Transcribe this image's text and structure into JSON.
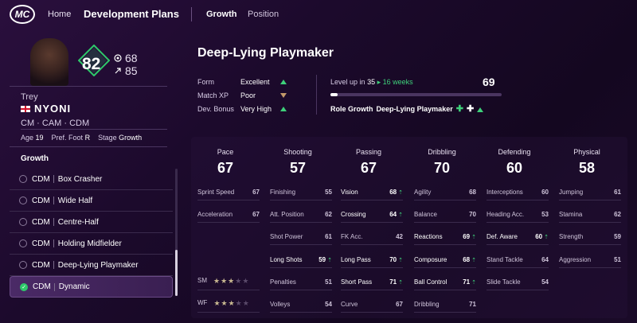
{
  "nav": {
    "logo": "MC",
    "home": "Home",
    "title": "Development Plans",
    "tabs": [
      "Growth",
      "Position"
    ]
  },
  "player": {
    "ovr": "82",
    "potential_a": "68",
    "potential_b": "85",
    "first_name": "Trey",
    "last_name": "NYONI",
    "positions": "CM · CAM · CDM",
    "age_label": "Age",
    "age": "19",
    "foot_label": "Pref. Foot",
    "foot": "R",
    "stage_label": "Stage",
    "stage": "Growth"
  },
  "growth": {
    "heading": "Growth",
    "plans": [
      {
        "pos": "CDM",
        "name": "Box Crasher"
      },
      {
        "pos": "CDM",
        "name": "Wide Half"
      },
      {
        "pos": "CDM",
        "name": "Centre-Half"
      },
      {
        "pos": "CDM",
        "name": "Holding Midfielder"
      },
      {
        "pos": "CDM",
        "name": "Deep-Lying Playmaker"
      },
      {
        "pos": "CDM",
        "name": "Dynamic"
      }
    ],
    "selected_index": 5
  },
  "role": {
    "title": "Deep-Lying Playmaker",
    "form_label": "Form",
    "form": "Excellent",
    "xp_label": "Match XP",
    "xp": "Poor",
    "bonus_label": "Dev. Bonus",
    "bonus": "Very High",
    "levelup_label": "Level up in",
    "levelup_from": "35",
    "levelup_weeks": "16 weeks",
    "level": "69",
    "progress": 0.04,
    "growth_label": "Role Growth",
    "growth_role": "Deep-Lying Playmaker"
  },
  "categories": [
    {
      "name": "Pace",
      "value": "67"
    },
    {
      "name": "Shooting",
      "value": "57"
    },
    {
      "name": "Passing",
      "value": "67"
    },
    {
      "name": "Dribbling",
      "value": "70"
    },
    {
      "name": "Defending",
      "value": "60"
    },
    {
      "name": "Physical",
      "value": "58"
    }
  ],
  "attributes": {
    "pace": [
      {
        "n": "Sprint Speed",
        "v": "67"
      },
      {
        "n": "Acceleration",
        "v": "67"
      }
    ],
    "shooting": [
      {
        "n": "Finishing",
        "v": "55"
      },
      {
        "n": "Att. Position",
        "v": "62"
      },
      {
        "n": "Shot Power",
        "v": "61"
      },
      {
        "n": "Long Shots",
        "v": "59"
      },
      {
        "n": "Penalties",
        "v": "51"
      },
      {
        "n": "Volleys",
        "v": "54"
      }
    ],
    "passing": [
      {
        "n": "Vision",
        "v": "68"
      },
      {
        "n": "Crossing",
        "v": "64"
      },
      {
        "n": "FK Acc.",
        "v": "42"
      },
      {
        "n": "Long Pass",
        "v": "70"
      },
      {
        "n": "Short Pass",
        "v": "71"
      },
      {
        "n": "Curve",
        "v": "67"
      }
    ],
    "dribbling": [
      {
        "n": "Agility",
        "v": "68"
      },
      {
        "n": "Balance",
        "v": "70"
      },
      {
        "n": "Reactions",
        "v": "69"
      },
      {
        "n": "Composure",
        "v": "68"
      },
      {
        "n": "Ball Control",
        "v": "71"
      },
      {
        "n": "Dribbling",
        "v": "71"
      }
    ],
    "defending": [
      {
        "n": "Interceptions",
        "v": "60"
      },
      {
        "n": "Heading Acc.",
        "v": "53"
      },
      {
        "n": "Def. Aware",
        "v": "60"
      },
      {
        "n": "Stand Tackle",
        "v": "64"
      },
      {
        "n": "Slide Tackle",
        "v": "54"
      }
    ],
    "physical": [
      {
        "n": "Jumping",
        "v": "61"
      },
      {
        "n": "Stamina",
        "v": "62"
      },
      {
        "n": "Strength",
        "v": "59"
      },
      {
        "n": "Aggression",
        "v": "51"
      }
    ]
  },
  "skill_moves": {
    "label": "SM",
    "stars": 3,
    "max": 5
  },
  "weak_foot": {
    "label": "WF",
    "stars": 3,
    "max": 5
  },
  "colors": {
    "accent_green": "#3ed07a",
    "background": "#1c0a2c"
  }
}
